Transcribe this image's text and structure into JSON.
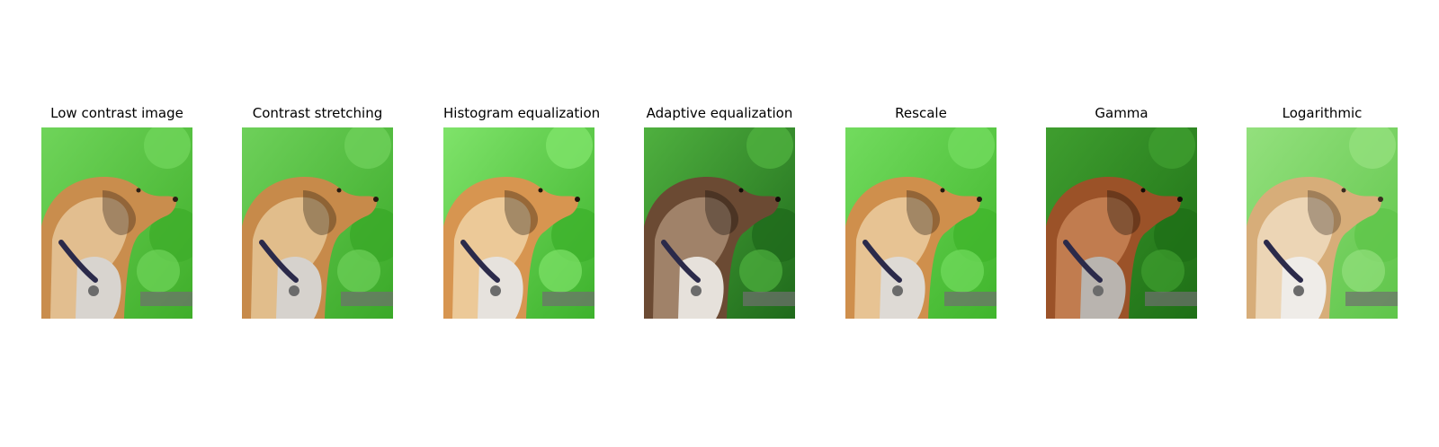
{
  "figure": {
    "panels": [
      {
        "id": "low-contrast",
        "title": "Low contrast image",
        "variant": "original"
      },
      {
        "id": "contrast-stretching",
        "title": "Contrast stretching",
        "variant": "stretched"
      },
      {
        "id": "histogram-equalization",
        "title": "Histogram equalization",
        "variant": "histeq"
      },
      {
        "id": "adaptive-equalization",
        "title": "Adaptive equalization",
        "variant": "adaptive"
      },
      {
        "id": "rescale",
        "title": "Rescale",
        "variant": "rescale"
      },
      {
        "id": "gamma",
        "title": "Gamma",
        "variant": "gamma"
      },
      {
        "id": "logarithmic",
        "title": "Logarithmic",
        "variant": "log"
      }
    ],
    "palette": {
      "original": {
        "bg1": "#3fae2a",
        "bg2": "#6fd45a",
        "fur1": "#c98d4d",
        "fur2": "#e6c79b",
        "chest": "#d8d4cf",
        "dark": "#2a1e14"
      },
      "stretched": {
        "bg1": "#3aa928",
        "bg2": "#6ed05a",
        "fur1": "#c78a4a",
        "fur2": "#e5c596",
        "chest": "#d6d2cd",
        "dark": "#24190f"
      },
      "histeq": {
        "bg1": "#3db22c",
        "bg2": "#7fe36a",
        "fur1": "#d79550",
        "fur2": "#f0d2a4",
        "chest": "#e6e2dd",
        "dark": "#1f140b"
      },
      "adaptive": {
        "bg1": "#1f6a1b",
        "bg2": "#4fb03f",
        "fur1": "#6b4a33",
        "fur2": "#a98c73",
        "chest": "#e6e1db",
        "dark": "#120c08"
      },
      "rescale": {
        "bg1": "#40b52c",
        "bg2": "#72db5e",
        "fur1": "#cf8f4c",
        "fur2": "#ebcca0",
        "chest": "#dedad5",
        "dark": "#221810"
      },
      "gamma": {
        "bg1": "#1e6f16",
        "bg2": "#3f9e2f",
        "fur1": "#9b5228",
        "fur2": "#c88456",
        "chest": "#b9b4af",
        "dark": "#120b06"
      },
      "log": {
        "bg1": "#5fc54a",
        "bg2": "#93e07d",
        "fur1": "#d7ad79",
        "fur2": "#f0dcc0",
        "chest": "#efece8",
        "dark": "#3a2b1f"
      }
    }
  }
}
